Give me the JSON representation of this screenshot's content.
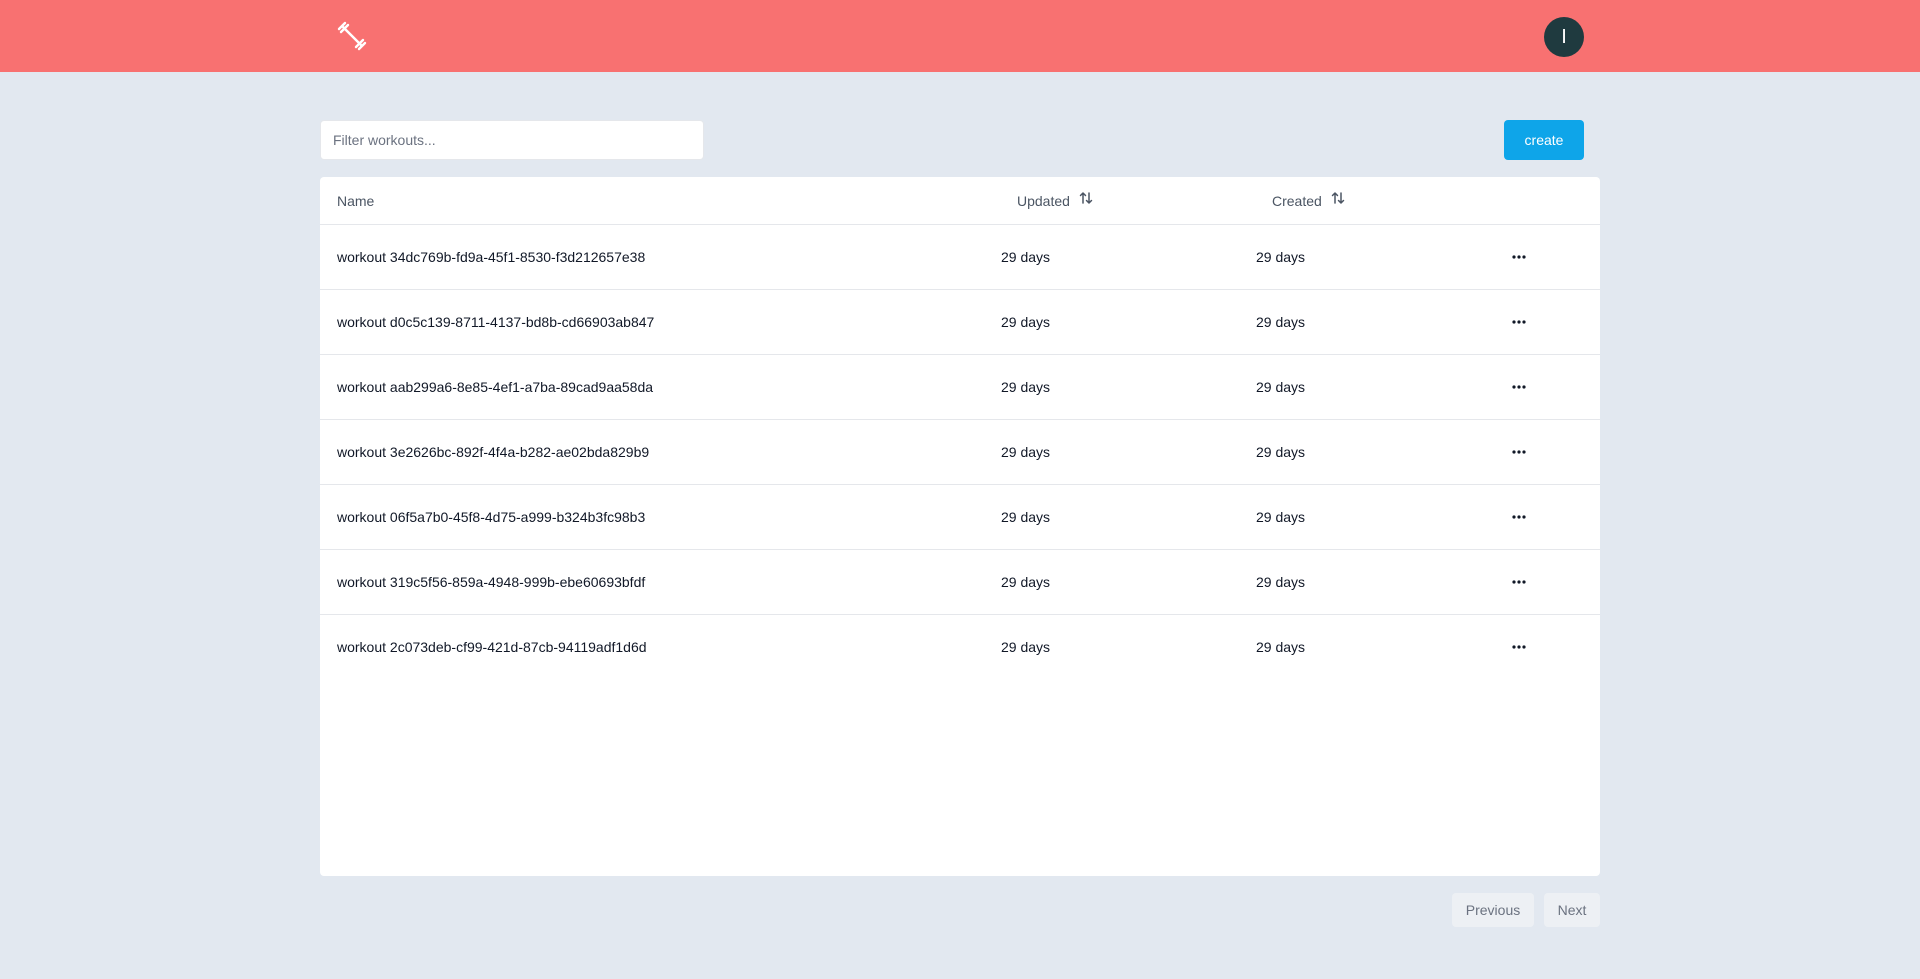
{
  "header": {
    "logo_icon": "dumbbell-icon",
    "avatar_initial": "I",
    "colors": {
      "bar": "#f87171",
      "avatar": "#1f3a3f"
    }
  },
  "toolbar": {
    "filter_placeholder": "Filter workouts...",
    "filter_value": "",
    "create_label": "create",
    "create_color": "#0ea5e9"
  },
  "table": {
    "columns": {
      "name": "Name",
      "updated": "Updated",
      "created": "Created"
    },
    "sort_icon": "sort-arrows-icon",
    "row_action_icon": "more-horizontal-icon",
    "rows": [
      {
        "name": "workout 34dc769b-fd9a-45f1-8530-f3d212657e38",
        "updated": "29 days",
        "created": "29 days"
      },
      {
        "name": "workout d0c5c139-8711-4137-bd8b-cd66903ab847",
        "updated": "29 days",
        "created": "29 days"
      },
      {
        "name": "workout aab299a6-8e85-4ef1-a7ba-89cad9aa58da",
        "updated": "29 days",
        "created": "29 days"
      },
      {
        "name": "workout 3e2626bc-892f-4f4a-b282-ae02bda829b9",
        "updated": "29 days",
        "created": "29 days"
      },
      {
        "name": "workout 06f5a7b0-45f8-4d75-a999-b324b3fc98b3",
        "updated": "29 days",
        "created": "29 days"
      },
      {
        "name": "workout 319c5f56-859a-4948-999b-ebe60693bfdf",
        "updated": "29 days",
        "created": "29 days"
      },
      {
        "name": "workout 2c073deb-cf99-421d-87cb-94119adf1d6d",
        "updated": "29 days",
        "created": "29 days"
      }
    ]
  },
  "pagination": {
    "previous_label": "Previous",
    "next_label": "Next"
  }
}
